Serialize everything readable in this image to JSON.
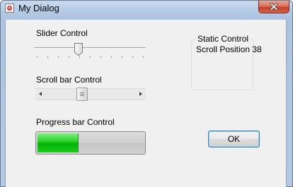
{
  "window": {
    "title": "My Dialog",
    "icon": "app-icon",
    "close_icon": "close-icon"
  },
  "slider": {
    "label": "Slider Control",
    "value_fraction": 0.38,
    "tick_count": 11
  },
  "scrollbar": {
    "label": "Scroll bar Control",
    "position": 38,
    "left_arrow_icon": "chevron-left-icon",
    "right_arrow_icon": "chevron-right-icon"
  },
  "progress": {
    "label": "Progress bar Control",
    "value_fraction": 0.38,
    "fill_color": "#16c416"
  },
  "static_group": {
    "title": "Static Control",
    "text": "Scroll Position 38"
  },
  "buttons": {
    "ok_label": "OK"
  },
  "colors": {
    "title_bar": "#b8cde6",
    "close_button": "#c4412b",
    "dialog_face": "#f0f0f0",
    "default_button_border": "#3c7fb1"
  }
}
